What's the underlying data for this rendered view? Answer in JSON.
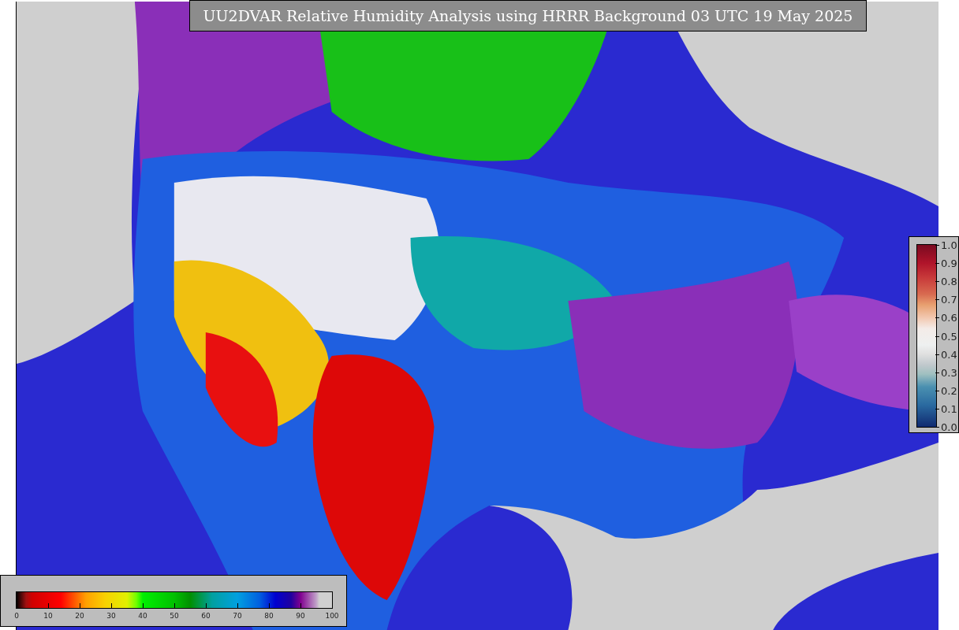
{
  "title": "UU2DVAR Relative Humidity Analysis using HRRR Background 03 UTC 19 May 2025",
  "humidity_colorbar": {
    "ticks": [
      "0",
      "10",
      "20",
      "30",
      "40",
      "50",
      "60",
      "70",
      "80",
      "90",
      "100"
    ]
  },
  "observation_colorbar": {
    "ticks": [
      "1.0",
      "0.9",
      "0.8",
      "0.7",
      "0.6",
      "0.5",
      "0.4",
      "0.3",
      "0.2",
      "0.1",
      "0.0"
    ]
  }
}
